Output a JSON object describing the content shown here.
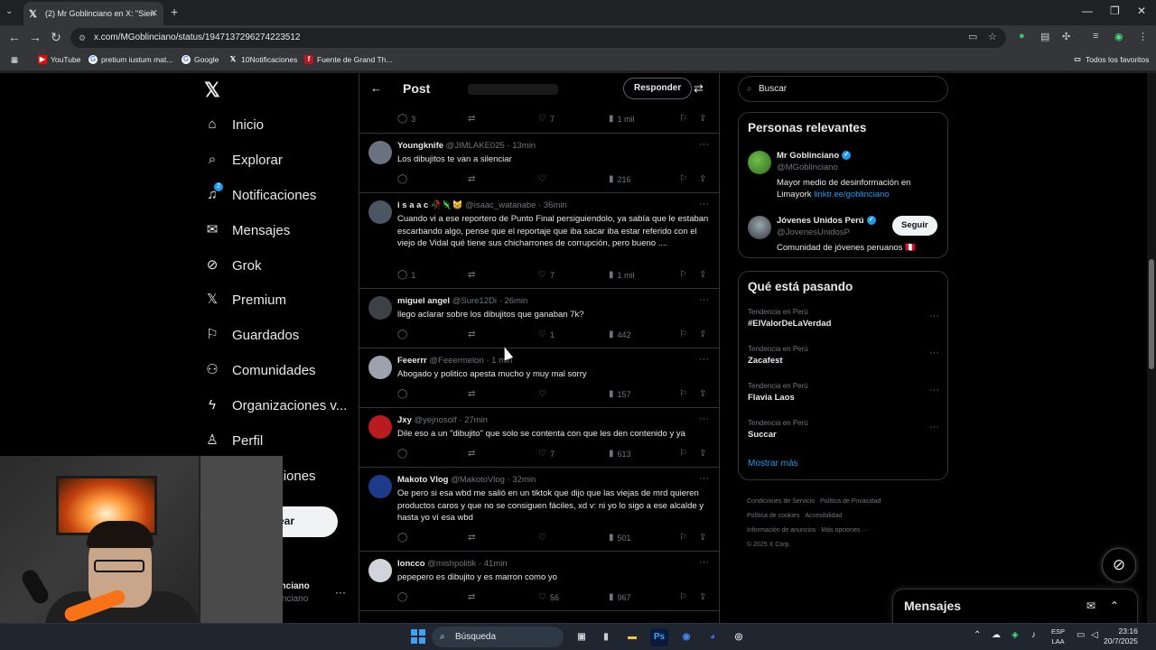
{
  "browser": {
    "tab_title": "(2) Mr Goblinciano en X: \"Sien",
    "url": "x.com/MGoblinciano/status/1947137296274223512",
    "bookmarks": [
      "YouTube",
      "pretium iustum mat...",
      "Google",
      "10Notificaciones",
      "Fuente de Grand Th..."
    ],
    "all_bookmarks": "Todos los favoritos"
  },
  "nav": {
    "items": [
      "Inicio",
      "Explorar",
      "Notificaciones",
      "Mensajes",
      "Grok",
      "Premium",
      "Guardados",
      "Comunidades",
      "Organizaciones v...",
      "Perfil",
      "Más opciones"
    ],
    "notif_badge": "2",
    "post_label": "Postear",
    "account_name": "Mr Goblinciano",
    "account_handle": "@MGoblinciano"
  },
  "header": {
    "title": "Post",
    "reply_button": "Responder"
  },
  "top_stats": {
    "replies": "3",
    "likes": "7",
    "views": "1 mil"
  },
  "replies": [
    {
      "name": "Youngknife",
      "handle": "@JIMLAKE025",
      "time": "13min",
      "text": "Los dibujitos te van a silenciar",
      "replies": "",
      "likes": "",
      "views": "216"
    },
    {
      "name": "i s a a c 🥀🦎😸",
      "handle": "@isaac_watanabe",
      "time": "36min",
      "text": "Cuando vi a ese reportero de Punto Final persiguiendolo, ya sabía que le estaban escarbando algo, pense que el reportaje que iba sacar iba estar referido con el viejo de Vidal qué tiene sus chicharrones de corrupción, pero bueno ....",
      "replies": "1",
      "likes": "7",
      "views": "1 mil"
    },
    {
      "name": "miguel angel",
      "handle": "@Sure12Di",
      "time": "26min",
      "text": "llego aclarar sobre los dibujitos que ganaban 7k?",
      "replies": "",
      "likes": "1",
      "views": "442"
    },
    {
      "name": "Feeerrr",
      "handle": "@Feeermelon",
      "time": "1 min",
      "text": "Abogado y politico apesta mucho y muy mal sorry",
      "replies": "",
      "likes": "",
      "views": "157"
    },
    {
      "name": "Jxy",
      "handle": "@yejnosolf",
      "time": "27min",
      "text": "Dile eso a un \"dibujito\" que solo se contenta con que les den contenido y ya",
      "replies": "",
      "likes": "7",
      "views": "613"
    },
    {
      "name": "Makoto Vlog",
      "handle": "@MakotoVlog",
      "time": "32min",
      "text": "Oe pero si esa wbd me salió en un tiktok que dijo que las viejas de mrd quieren productos caros y que no se consiguen fáciles, xd v: ni yo lo sigo a ese alcalde y hasta yo ví esa wbd",
      "replies": "",
      "likes": "",
      "views": "501"
    },
    {
      "name": "loncco",
      "handle": "@mishpolitik",
      "time": "41min",
      "text": "pepepero es dibujito y es marron como yo",
      "replies": "",
      "likes": "56",
      "views": "967"
    }
  ],
  "sidebar": {
    "search_placeholder": "Buscar",
    "relevant_title": "Personas relevantes",
    "people": [
      {
        "name": "Mr Goblinciano",
        "handle": "@MGoblinciano",
        "bio": "Mayor medio de desinformación en Limayork ",
        "link": "linktr.ee/goblinciano"
      },
      {
        "name": "Jóvenes Unidos Perú",
        "handle": "@JovenesUnidosP",
        "bio": "Comunidad de jóvenes peruanos 🇵🇪",
        "follow": "Seguir"
      }
    ],
    "trends_title": "Qué está pasando",
    "trends": [
      {
        "meta": "Tendencia en Perú",
        "name": "#ElValorDeLaVerdad"
      },
      {
        "meta": "Tendencia en Perú",
        "name": "Zacafest"
      },
      {
        "meta": "Tendencia en Perú",
        "name": "Flavia Laos"
      },
      {
        "meta": "Tendencia en Perú",
        "name": "Succar"
      }
    ],
    "show_more": "Mostrar más",
    "footer": [
      "Condiciones de Servicio",
      "Política de Privacidad",
      "Política de cookies",
      "Accesibilidad",
      "Información de anuncios",
      "Más opciones ···",
      "© 2025 X Corp."
    ]
  },
  "dm_drawer": {
    "title": "Mensajes"
  },
  "taskbar": {
    "search": "Búsqueda",
    "lang_top": "ESP",
    "lang_bottom": "LAA",
    "time": "23:16",
    "date": "20/7/2025"
  }
}
